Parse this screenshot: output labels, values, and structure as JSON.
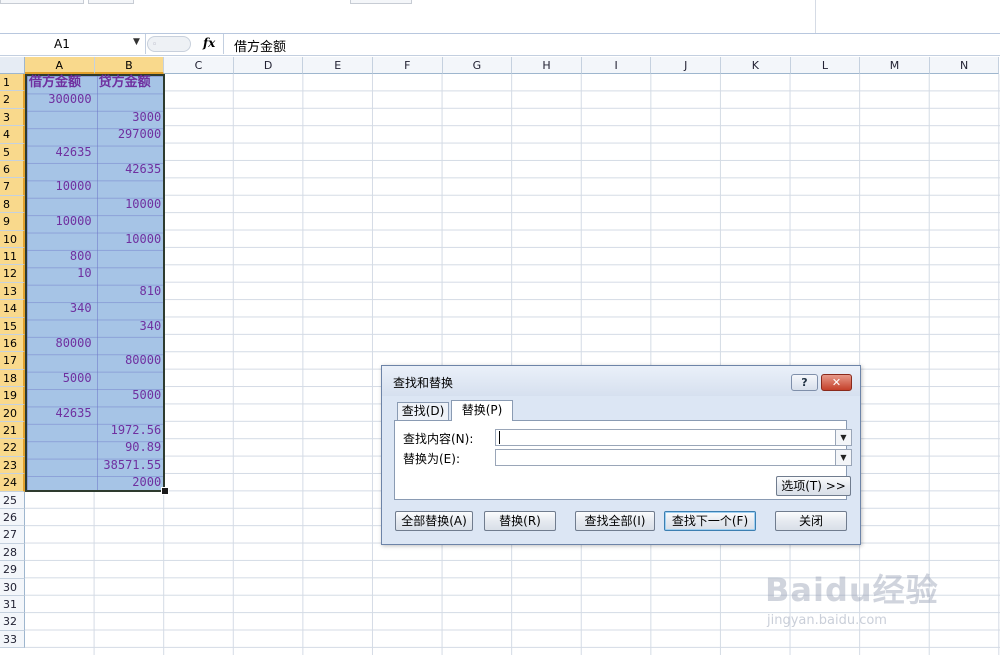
{
  "formula_bar": {
    "name_box": "A1",
    "fx": "fx",
    "content": "借方金额"
  },
  "columns": [
    "A",
    "B",
    "C",
    "D",
    "E",
    "F",
    "G",
    "H",
    "I",
    "J",
    "K",
    "L",
    "M",
    "N"
  ],
  "rows": [
    "1",
    "2",
    "3",
    "4",
    "5",
    "6",
    "7",
    "8",
    "9",
    "10",
    "11",
    "12",
    "13",
    "14",
    "15",
    "16",
    "17",
    "18",
    "19",
    "20",
    "21",
    "22",
    "23",
    "24",
    "25",
    "26",
    "27",
    "28",
    "29",
    "30",
    "31",
    "32",
    "33"
  ],
  "sheet": {
    "header_a": "借方金额",
    "header_b": "贷方金额",
    "col_a": [
      "300000",
      "",
      "",
      "42635",
      "",
      "10000",
      "",
      "10000",
      "",
      "800",
      "10",
      "",
      "340",
      "",
      "80000",
      "",
      "5000",
      "",
      "42635",
      "",
      "",
      "",
      "",
      ""
    ],
    "col_b": [
      "",
      "3000",
      "297000",
      "",
      "42635",
      "",
      "10000",
      "",
      "10000",
      "",
      "",
      "810",
      "",
      "340",
      "",
      "80000",
      "",
      "5000",
      "",
      "1972.56",
      "90.89",
      "38571.55",
      "2000",
      ""
    ]
  },
  "dialog": {
    "title": "查找和替换",
    "help_label": "?",
    "close_label": "✕",
    "tab_find": "查找(D)",
    "tab_replace": "替换(P)",
    "find_label": "查找内容(N):",
    "find_value": "",
    "replace_label": "替换为(E):",
    "replace_value": "",
    "options_button": "选项(T) >>",
    "replace_all_button": "全部替换(A)",
    "replace_button": "替换(R)",
    "find_all_button": "查找全部(I)",
    "find_next_button": "查找下一个(F)",
    "close_button": "关闭"
  },
  "watermark": {
    "brand": "Baidu经验",
    "url": "jingyan.baidu.com"
  },
  "colors": {
    "cell_text": "#6f30a0",
    "selection_fill": "#a6c4e6",
    "header_selected": "#f9d98c"
  }
}
